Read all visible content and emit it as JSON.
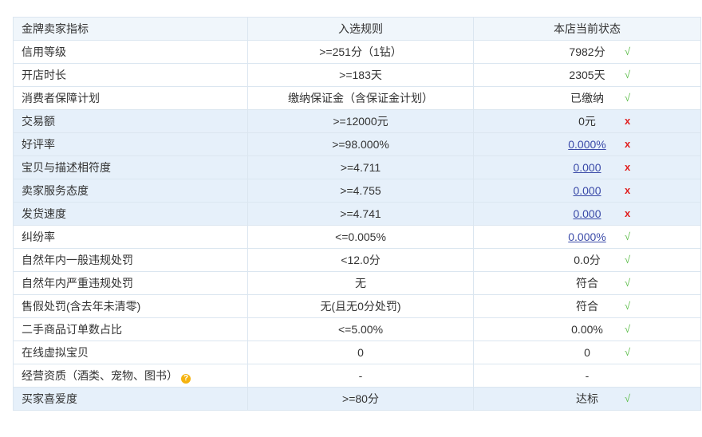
{
  "header": {
    "col1": "金牌卖家指标",
    "col2": "入选规则",
    "col3": "本店当前状态"
  },
  "rows": [
    {
      "name": "信用等级",
      "rule": ">=251分（1钻）",
      "status": "7982分",
      "link": false,
      "mark": "√"
    },
    {
      "name": "开店时长",
      "rule": ">=183天",
      "status": "2305天",
      "link": false,
      "mark": "√"
    },
    {
      "name": "消费者保障计划",
      "rule": "缴纳保证金（含保证金计划）",
      "status": "已缴纳",
      "link": false,
      "mark": "√"
    },
    {
      "name": "交易额",
      "rule": ">=12000元",
      "status": "0元",
      "link": false,
      "mark": "x"
    },
    {
      "name": "好评率",
      "rule": ">=98.000%",
      "status": "0.000%",
      "link": true,
      "mark": "x"
    },
    {
      "name": "宝贝与描述相符度",
      "rule": ">=4.711",
      "status": "0.000",
      "link": true,
      "mark": "x"
    },
    {
      "name": "卖家服务态度",
      "rule": ">=4.755",
      "status": "0.000",
      "link": true,
      "mark": "x"
    },
    {
      "name": "发货速度",
      "rule": ">=4.741",
      "status": "0.000",
      "link": true,
      "mark": "x"
    },
    {
      "name": "纠纷率",
      "rule": "<=0.005%",
      "status": "0.000%",
      "link": true,
      "mark": "√"
    },
    {
      "name": "自然年内一般违规处罚",
      "rule": "<12.0分",
      "status": "0.0分",
      "link": false,
      "mark": "√"
    },
    {
      "name": "自然年内严重违规处罚",
      "rule": "无",
      "status": "符合",
      "link": false,
      "mark": "√"
    },
    {
      "name": "售假处罚(含去年未清零)",
      "rule": "无(且无0分处罚)",
      "status": "符合",
      "link": false,
      "mark": "√"
    },
    {
      "name": "二手商品订单数占比",
      "rule": "<=5.00%",
      "status": "0.00%",
      "link": false,
      "mark": "√"
    },
    {
      "name": "在线虚拟宝贝",
      "rule": "0",
      "status": "0",
      "link": false,
      "mark": "√"
    },
    {
      "name": "经营资质（酒类、宠物、图书）",
      "rule": "-",
      "status": "-",
      "link": false,
      "mark": "",
      "help": "?"
    },
    {
      "name": "买家喜爱度",
      "rule": ">=80分",
      "status": "达标",
      "link": false,
      "mark": "√"
    }
  ],
  "colors": {
    "ok": "#5fbf4c",
    "fail": "#e02020",
    "link": "#3a4aa8",
    "highlight": "#e6f0fa",
    "border": "#dbe6f0"
  }
}
